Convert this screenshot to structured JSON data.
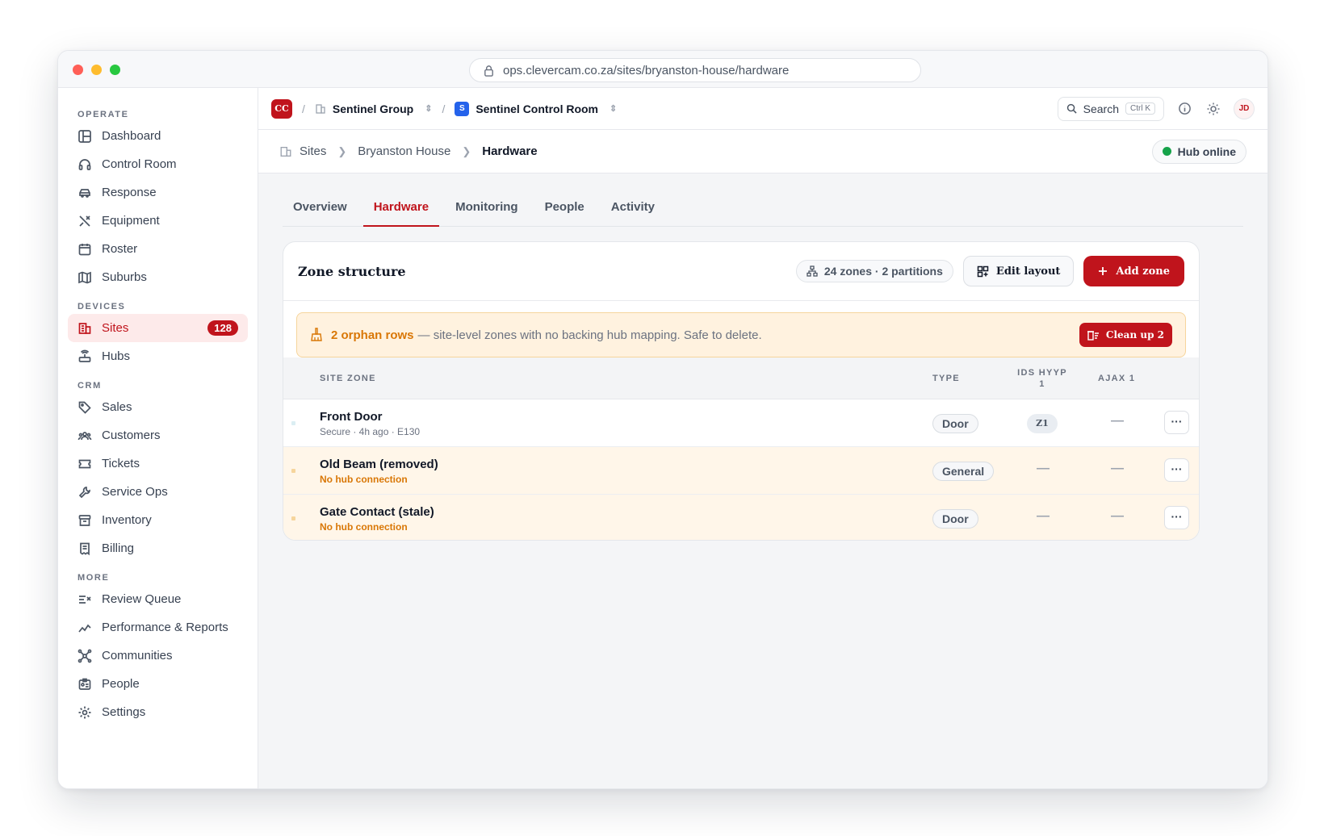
{
  "browser": {
    "url": "ops.clevercam.co.za/sites/bryanston-house/hardware"
  },
  "sidebar": {
    "sections": [
      {
        "title": "OPERATE",
        "items": [
          {
            "label": "Dashboard",
            "icon": "layout-icon"
          },
          {
            "label": "Control Room",
            "icon": "headset-icon"
          },
          {
            "label": "Response",
            "icon": "car-icon"
          },
          {
            "label": "Equipment",
            "icon": "tools-icon"
          },
          {
            "label": "Roster",
            "icon": "calendar-icon"
          },
          {
            "label": "Suburbs",
            "icon": "map-icon"
          }
        ]
      },
      {
        "title": "DEVICES",
        "items": [
          {
            "label": "Sites",
            "icon": "building-icon",
            "badge": "128",
            "active": true
          },
          {
            "label": "Hubs",
            "icon": "router-icon"
          }
        ]
      },
      {
        "title": "CRM",
        "items": [
          {
            "label": "Sales",
            "icon": "tag-icon"
          },
          {
            "label": "Customers",
            "icon": "users-icon"
          },
          {
            "label": "Tickets",
            "icon": "ticket-icon"
          },
          {
            "label": "Service Ops",
            "icon": "wrench-icon"
          },
          {
            "label": "Inventory",
            "icon": "archive-icon"
          },
          {
            "label": "Billing",
            "icon": "receipt-icon"
          }
        ]
      },
      {
        "title": "MORE",
        "items": [
          {
            "label": "Review Queue",
            "icon": "list-check-icon"
          },
          {
            "label": "Performance & Reports",
            "icon": "trend-icon"
          },
          {
            "label": "Communities",
            "icon": "network-icon"
          },
          {
            "label": "People",
            "icon": "id-badge-icon"
          },
          {
            "label": "Settings",
            "icon": "gear-icon"
          }
        ]
      }
    ]
  },
  "topbar": {
    "logo": "CC",
    "org": "Sentinel Group",
    "room_badge": "S",
    "room": "Sentinel Control Room",
    "search_label": "Search",
    "search_shortcut": "Ctrl K",
    "avatar": "JD"
  },
  "breadcrumb": {
    "items": [
      "Sites",
      "Bryanston House",
      "Hardware"
    ]
  },
  "hub_status": "Hub online",
  "tabs": [
    {
      "label": "Overview"
    },
    {
      "label": "Hardware",
      "active": true
    },
    {
      "label": "Monitoring"
    },
    {
      "label": "People"
    },
    {
      "label": "Activity"
    }
  ],
  "card": {
    "title": "Zone structure",
    "summary": "24 zones · 2 partitions",
    "edit_label": "Edit layout",
    "add_label": "Add zone"
  },
  "banner": {
    "highlight": "2 orphan rows",
    "text": "— site-level zones with no backing hub mapping. Safe to delete.",
    "button": "Clean up 2"
  },
  "table": {
    "headers": [
      "SITE ZONE",
      "TYPE",
      "IDS HYYP 1",
      "AJAX 1"
    ],
    "rows": [
      {
        "name": "Front Door",
        "sub": "Secure · 4h ago · E130",
        "type": "Door",
        "ids": "Z1",
        "ajax": "—",
        "orphan": false
      },
      {
        "name": "Old Beam (removed)",
        "sub": "No hub connection",
        "type": "General",
        "ids": "—",
        "ajax": "—",
        "orphan": true
      },
      {
        "name": "Gate Contact (stale)",
        "sub": "No hub connection",
        "type": "Door",
        "ids": "—",
        "ajax": "—",
        "orphan": true
      }
    ],
    "row_menu": "···"
  },
  "colors": {
    "accent": "#c0141c",
    "warning": "#d97706",
    "success": "#16a34a",
    "link_blue": "#2563eb"
  }
}
